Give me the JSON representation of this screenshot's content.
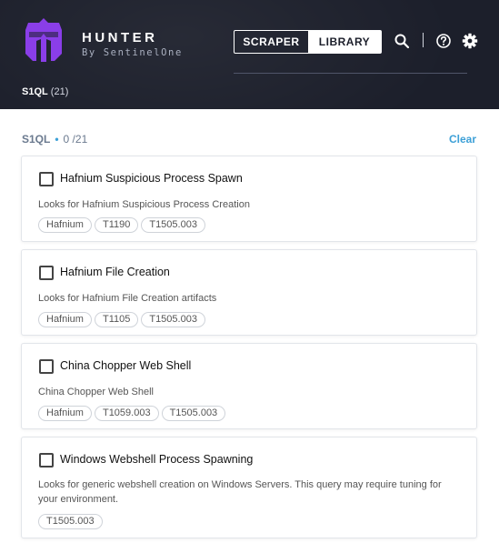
{
  "header": {
    "title": "HUNTER",
    "subtitle": "By SentinelOne",
    "tabs": [
      {
        "label": "SCRAPER",
        "active": true
      },
      {
        "label": "LIBRARY",
        "active": false
      }
    ],
    "icons": [
      "search-icon",
      "help-icon",
      "gear-icon"
    ],
    "query_tab": {
      "name": "S1QL",
      "count": "(21)"
    }
  },
  "colors": {
    "header_bg": "#1c1f2b",
    "accent": "#3da0d7",
    "logo": "#8a3ee8"
  },
  "list": {
    "label": "S1QL",
    "selected": "0 /21",
    "clear_label": "Clear"
  },
  "queries": [
    {
      "title": "Hafnium Suspicious Process Spawn",
      "description": "Looks for Hafnium Suspicious Process Creation",
      "tags": [
        "Hafnium",
        "T1190",
        "T1505.003"
      ],
      "checked": false
    },
    {
      "title": "Hafnium File Creation",
      "description": "Looks for Hafnium File Creation artifacts",
      "tags": [
        "Hafnium",
        "T1105",
        "T1505.003"
      ],
      "checked": false
    },
    {
      "title": "China Chopper Web Shell",
      "description": "China Chopper Web Shell",
      "tags": [
        "Hafnium",
        "T1059.003",
        "T1505.003"
      ],
      "checked": false
    },
    {
      "title": "Windows Webshell Process Spawning",
      "description": "Looks for generic webshell creation on Windows Servers. This query may require tuning for your environment.",
      "tags": [
        "T1505.003"
      ],
      "checked": false
    }
  ]
}
